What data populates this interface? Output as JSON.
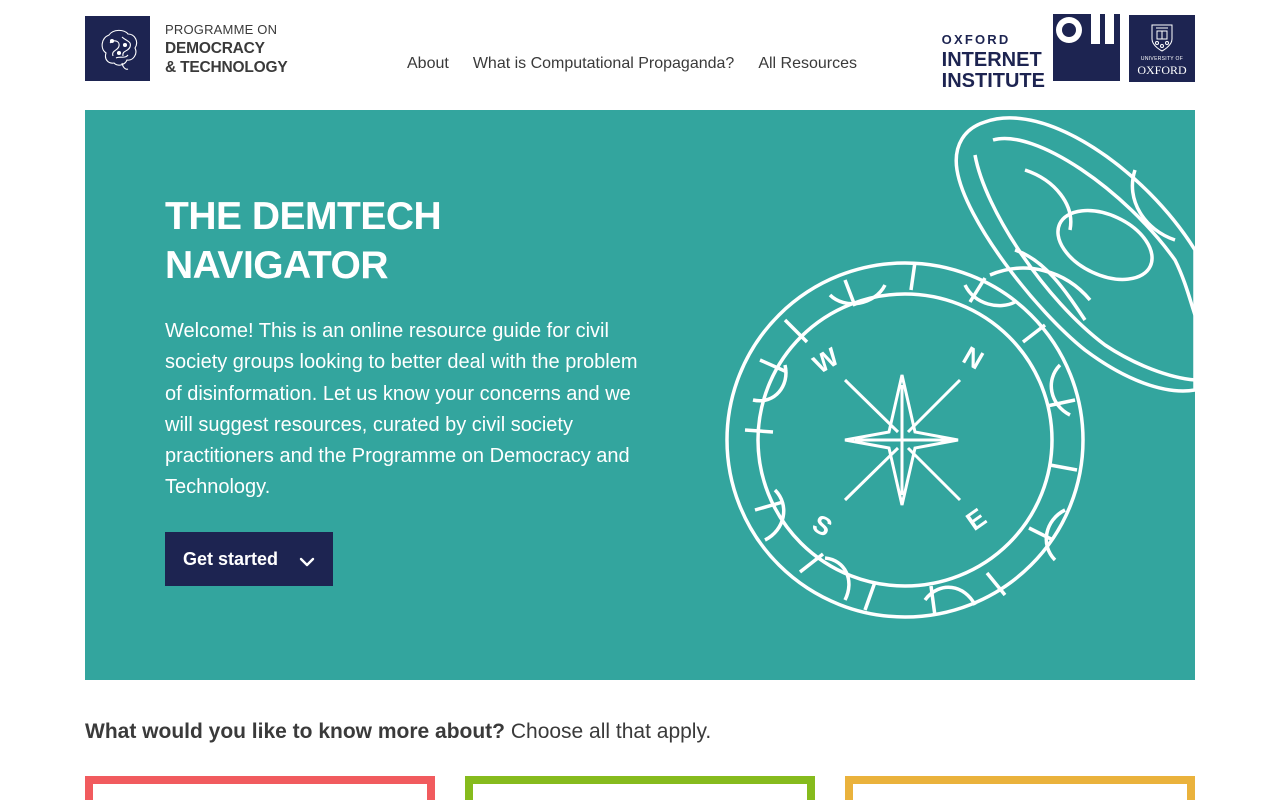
{
  "header": {
    "pdt_logo": {
      "line1": "PROGRAMME ON",
      "line2": "DEMOCRACY",
      "line3": "& TECHNOLOGY"
    },
    "nav": [
      {
        "label": "About"
      },
      {
        "label": "What is Computational Propaganda?"
      },
      {
        "label": "All Resources"
      }
    ],
    "oii_logo": {
      "line1": "OXFORD",
      "line2": "INTERNET",
      "line3": "INSTITUTE"
    },
    "oxford_logo": {
      "line1": "UNIVERSITY OF",
      "line2": "OXFORD"
    }
  },
  "hero": {
    "title_line1": "THE DEMTECH",
    "title_line2": "NAVIGATOR",
    "body": "Welcome! This is an online resource guide for civil society groups looking to better deal with the problem of disinformation. Let us know your concerns and we will suggest resources, curated by civil society practitioners and the Programme on Democracy and Technology.",
    "cta_label": "Get started",
    "compass": {
      "n": "N",
      "e": "E",
      "s": "S",
      "w": "W"
    }
  },
  "question": {
    "prompt": "What would you like to know more about?",
    "hint": "Choose all that apply."
  },
  "colors": {
    "navy": "#1d2451",
    "teal": "#33a59e",
    "card_red": "#f15b5e",
    "card_green": "#86bb1d",
    "card_yellow": "#eab23c"
  }
}
